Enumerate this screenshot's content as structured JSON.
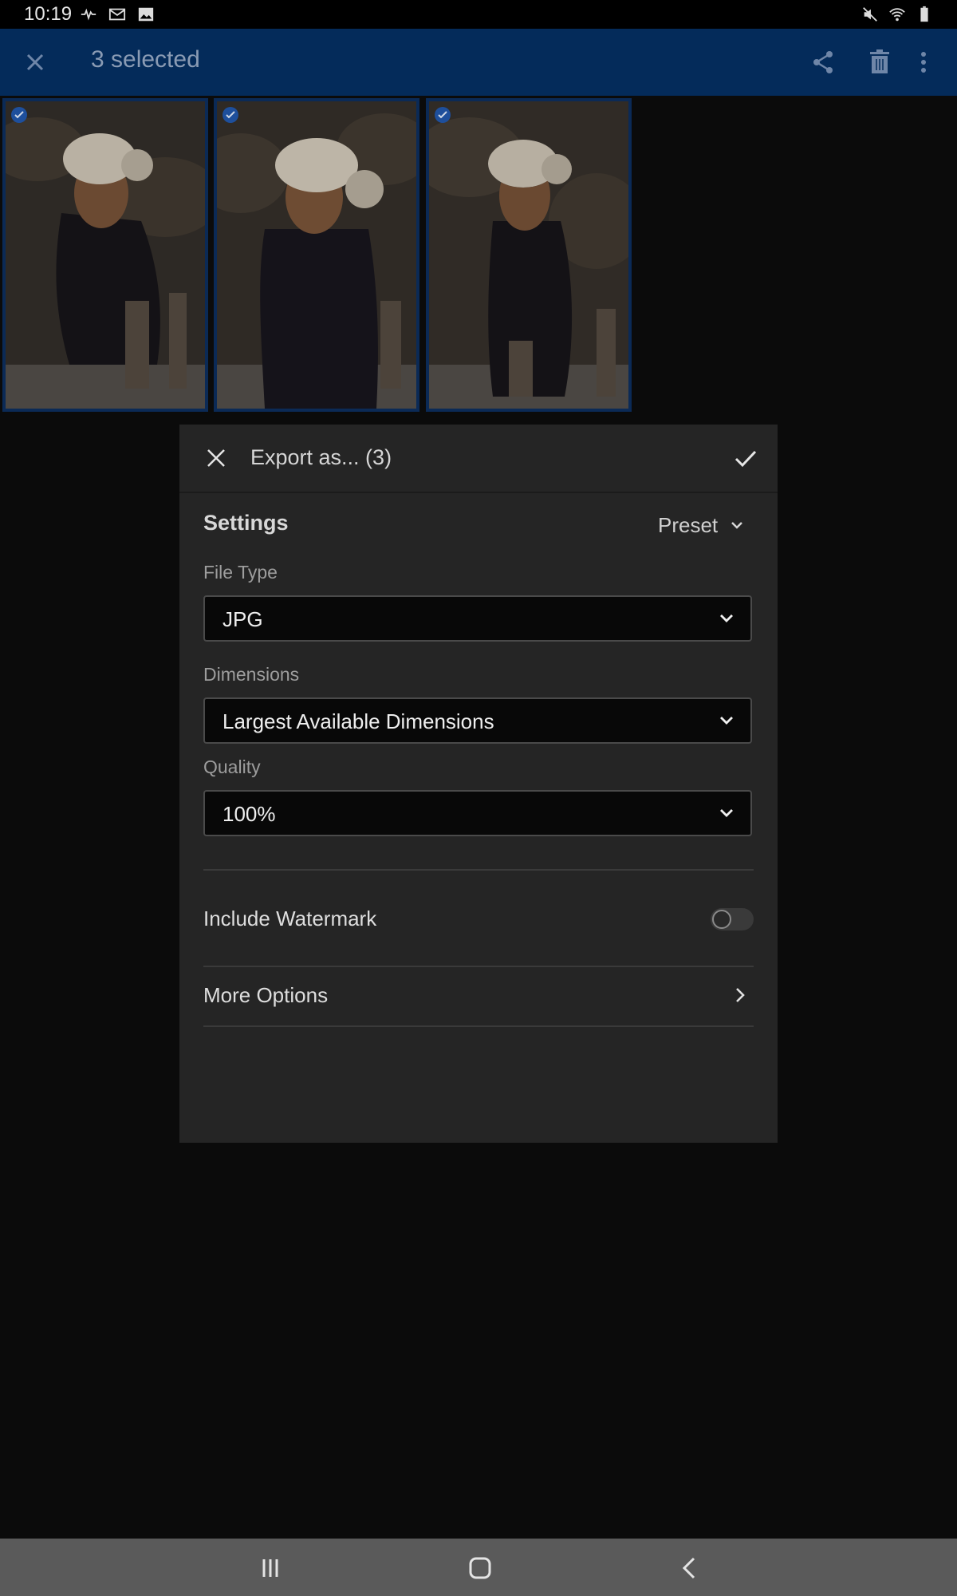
{
  "status_bar": {
    "time": "10:19",
    "left_icons": [
      "activity-icon",
      "outlook-icon",
      "image-icon"
    ],
    "right_icons": [
      "mute-icon",
      "wifi-icon",
      "battery-icon"
    ]
  },
  "header": {
    "title": "3 selected",
    "close_icon": "close-icon",
    "actions": [
      "share-icon",
      "delete-icon",
      "more-vert-icon"
    ],
    "background": "#042b5a"
  },
  "thumbnails": [
    {
      "selected": true
    },
    {
      "selected": true
    },
    {
      "selected": true
    }
  ],
  "dialog": {
    "title": "Export as... (3)",
    "settings_label": "Settings",
    "preset_label": "Preset",
    "file_type": {
      "label": "File Type",
      "value": "JPG"
    },
    "dimensions": {
      "label": "Dimensions",
      "value": "Largest Available Dimensions"
    },
    "quality": {
      "label": "Quality",
      "value": "100%"
    },
    "watermark": {
      "label": "Include Watermark",
      "enabled": false
    },
    "more_options_label": "More Options"
  },
  "nav_bar": {
    "buttons": [
      "recents-icon",
      "home-icon",
      "back-icon"
    ]
  },
  "colors": {
    "selection_border": "#0b2a56",
    "check_badge": "#1e5bb8",
    "dialog_bg": "#252525"
  }
}
